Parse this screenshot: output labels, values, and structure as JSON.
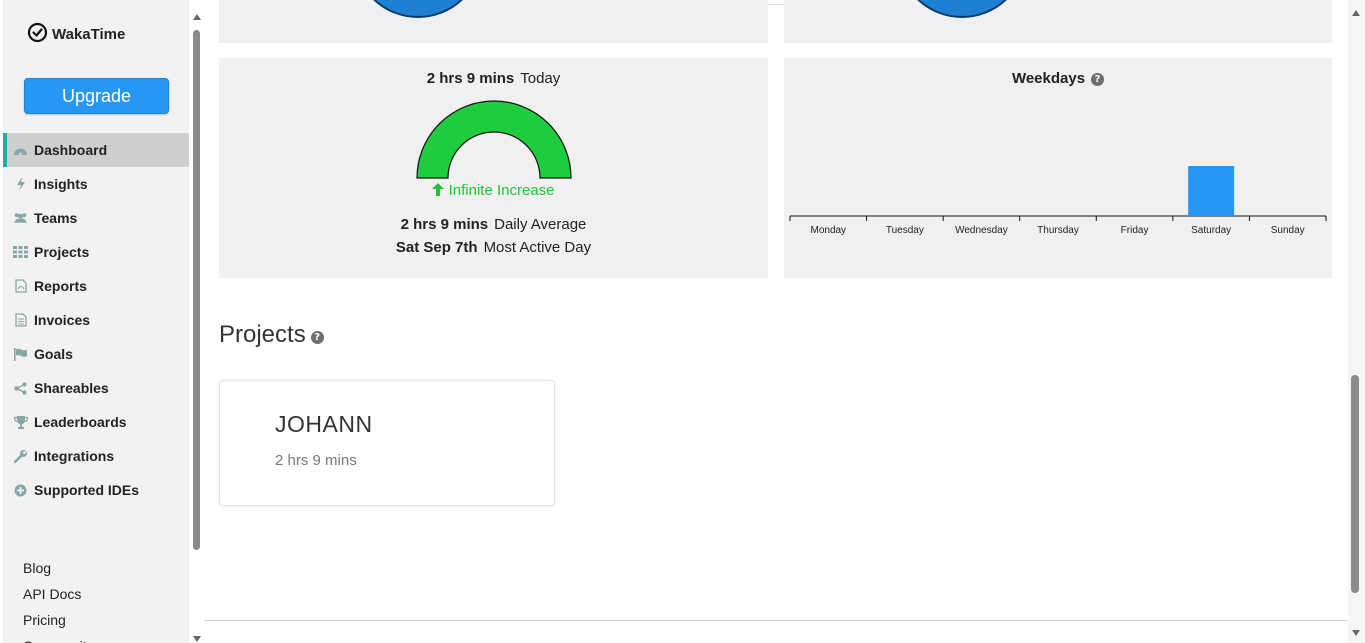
{
  "app": {
    "name": "WakaTime"
  },
  "sidebar": {
    "upgrade_label": "Upgrade",
    "items": [
      {
        "label": "Dashboard",
        "icon": "dashboard-icon",
        "active": true
      },
      {
        "label": "Insights",
        "icon": "bolt-icon"
      },
      {
        "label": "Teams",
        "icon": "users-icon"
      },
      {
        "label": "Projects",
        "icon": "grid-icon"
      },
      {
        "label": "Reports",
        "icon": "pdf-file-icon"
      },
      {
        "label": "Invoices",
        "icon": "file-text-icon"
      },
      {
        "label": "Goals",
        "icon": "flag-icon"
      },
      {
        "label": "Shareables",
        "icon": "share-icon"
      },
      {
        "label": "Leaderboards",
        "icon": "trophy-icon"
      },
      {
        "label": "Integrations",
        "icon": "wrench-icon"
      },
      {
        "label": "Supported IDEs",
        "icon": "plus-circle-icon"
      }
    ],
    "footer_links": [
      "Blog",
      "API Docs",
      "Pricing",
      "Community"
    ]
  },
  "today_card": {
    "today_value": "2 hrs 9 mins",
    "today_label": "Today",
    "change_text": "Infinite Increase",
    "daily_average_value": "2 hrs 9 mins",
    "daily_average_label": "Daily Average",
    "most_active_value": "Sat Sep 7th",
    "most_active_label": "Most Active Day",
    "gauge_fraction": 1.0,
    "gauge_color": "#1ecd3f",
    "increase_color": "#22c33a"
  },
  "weekdays_card": {
    "title": "Weekdays",
    "help_icon": "question-circle-icon"
  },
  "chart_data": {
    "type": "bar",
    "title": "Weekdays",
    "categories": [
      "Monday",
      "Tuesday",
      "Wednesday",
      "Thursday",
      "Friday",
      "Saturday",
      "Sunday"
    ],
    "values": [
      0,
      0,
      0,
      0,
      0,
      1,
      0
    ],
    "bar_color": "#2697f2",
    "ylim": [
      0,
      1
    ],
    "grid": false
  },
  "projects_section": {
    "title": "Projects",
    "help_icon": "question-circle-icon",
    "projects": [
      {
        "name": "JOHANN",
        "time": "2 hrs 9 mins"
      }
    ]
  },
  "colors": {
    "accent": "#2697f2",
    "active_border": "#2aa6a6",
    "card_bg": "#f0f0f0"
  }
}
